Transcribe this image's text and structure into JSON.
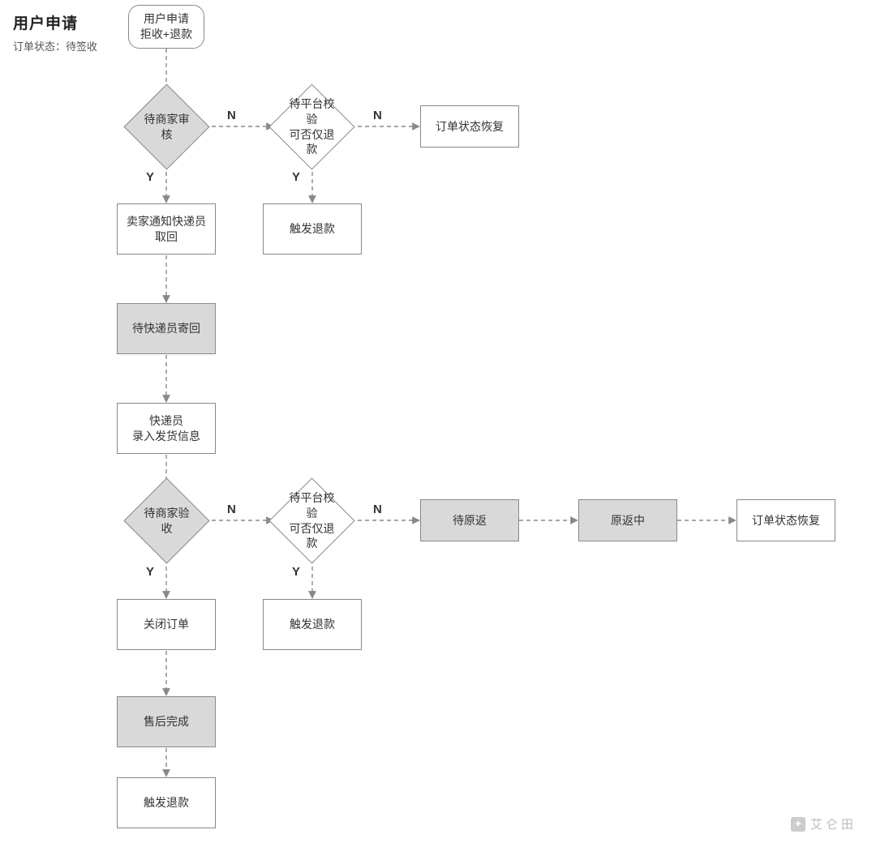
{
  "header": {
    "title": "用户申请",
    "subtitle": "订单状态：待签收"
  },
  "nodes": {
    "start": {
      "l1": "用户申请",
      "l2": "拒收+退款"
    },
    "d1": "待商家审核",
    "d2": {
      "l1": "待平台校验",
      "l2": "可否仅退款"
    },
    "restore1": "订单状态恢复",
    "refund1": "触发退款",
    "notify": {
      "l1": "卖家通知快递员",
      "l2": "取回"
    },
    "waitCourier": "待快递员寄回",
    "enterShip": {
      "l1": "快递员",
      "l2": "录入发货信息"
    },
    "d3": "待商家验收",
    "d4": {
      "l1": "待平台校验",
      "l2": "可否仅退款"
    },
    "waitReturn": "待原返",
    "returning": "原返中",
    "restore2": "订单状态恢复",
    "refund2": "触发退款",
    "close": "关闭订单",
    "done": "售后完成",
    "refund3": "触发退款"
  },
  "labels": {
    "yes": "Y",
    "no": "N"
  },
  "watermark": "艾仑田"
}
